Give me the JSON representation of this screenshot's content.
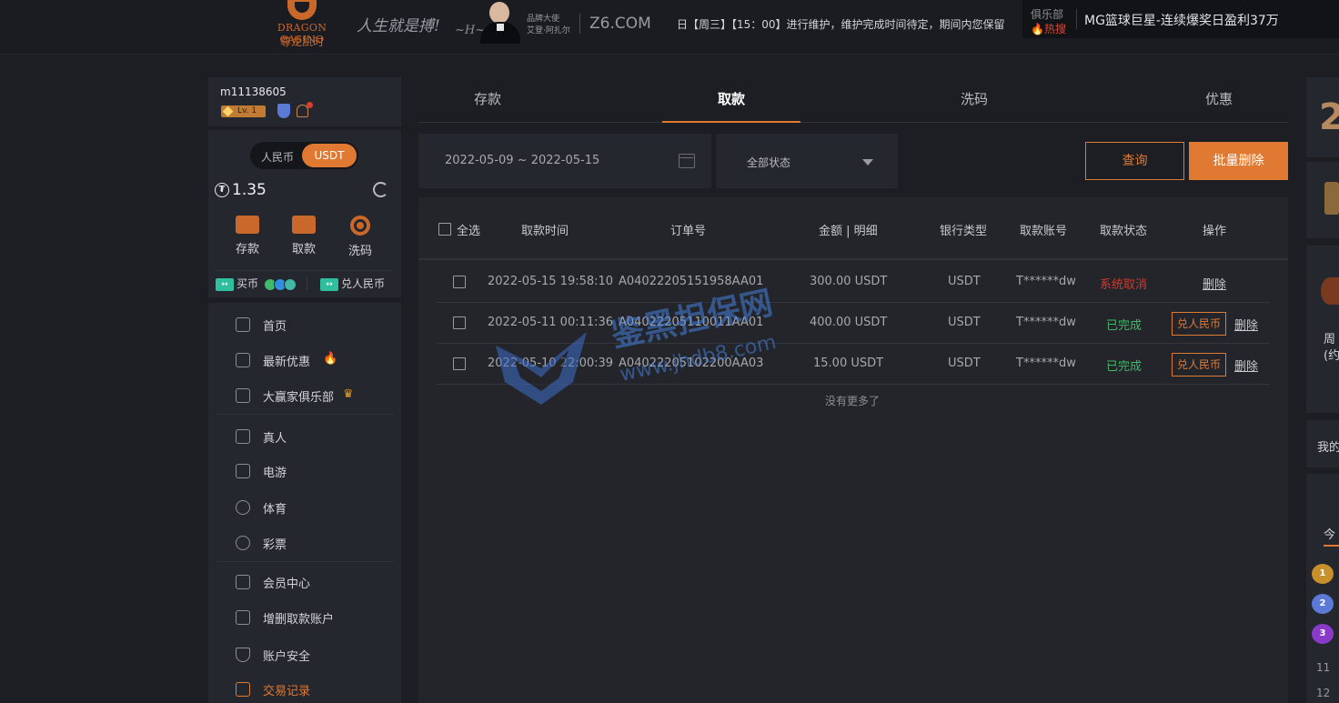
{
  "header": {
    "logo_en": "DRAGON CASINO",
    "logo_cn": "尊龙凯时",
    "slogan": "人生就是搏!",
    "ambassador_line1": "品牌大使",
    "ambassador_line2": "艾登·阿扎尔",
    "domain": "Z6.COM",
    "marquee": "日【周三】【15：00】进行维护，维护完成时间待定，期间内您保留",
    "club_label": "俱乐部",
    "hot_label": "热搜",
    "hot_news": "MG篮球巨星-连续爆奖日盈利37万"
  },
  "sidebar": {
    "username": "m11138605",
    "vip": "Lv. 1",
    "currency_cny": "人民币",
    "currency_usdt": "USDT",
    "balance": "1.35",
    "actions": [
      {
        "label": "存款",
        "icon": "card-icon"
      },
      {
        "label": "取款",
        "icon": "wallet-icon"
      },
      {
        "label": "洗码",
        "icon": "chip-icon"
      }
    ],
    "buy_coin": "买币",
    "exchange": "兑人民币",
    "nav": [
      {
        "label": "首页",
        "icon": "home-icon"
      },
      {
        "label": "最新优惠",
        "icon": "gift-icon"
      },
      {
        "label": "大赢家俱乐部",
        "icon": "chat-icon"
      },
      {
        "label": "真人",
        "icon": "cards-icon"
      },
      {
        "label": "电游",
        "icon": "slot-icon"
      },
      {
        "label": "体育",
        "icon": "ball-icon"
      },
      {
        "label": "彩票",
        "icon": "lottery-icon"
      },
      {
        "label": "会员中心",
        "icon": "id-card-icon"
      },
      {
        "label": "增删取款账户",
        "icon": "bank-card-icon"
      },
      {
        "label": "账户安全",
        "icon": "shield-icon"
      },
      {
        "label": "交易记录",
        "icon": "record-icon"
      }
    ]
  },
  "tabs": [
    "存款",
    "取款",
    "洗码",
    "优惠"
  ],
  "filters": {
    "date_range": "2022-05-09 ~ 2022-05-15",
    "status": "全部状态",
    "query_button": "查询",
    "batch_delete_button": "批量删除"
  },
  "table": {
    "select_all": "全选",
    "headers": [
      "取款时间",
      "订单号",
      "金额 | 明细",
      "银行类型",
      "取款账号",
      "取款状态",
      "操作"
    ],
    "rows": [
      {
        "time": "2022-05-15 19:58:10",
        "order": "A04022205151958AA01",
        "amount": "300.00 USDT",
        "bank": "USDT",
        "account": "T******dw",
        "status": "系统取消",
        "action": "删除"
      },
      {
        "time": "2022-05-11 00:11:36",
        "order": "A04022205110011AA01",
        "amount": "400.00 USDT",
        "bank": "USDT",
        "account": "T******dw",
        "status": "已完成",
        "exchange": "兑人民币",
        "action": "删除"
      },
      {
        "time": "2022-05-10 22:00:39",
        "order": "A04022205102200AA03",
        "amount": "15.00 USDT",
        "bank": "USDT",
        "account": "T******dw",
        "status": "已完成",
        "exchange": "兑人民币",
        "action": "删除"
      }
    ],
    "no_more": "没有更多了"
  },
  "watermark": {
    "text": "鉴黑担保网",
    "url": "www.jhdb8.com"
  },
  "right_panel": {
    "year_digit": "2",
    "text1": "周",
    "text2": "(约",
    "text3": "我的",
    "text4": "今",
    "ranks": [
      "1",
      "2",
      "3"
    ],
    "nums": [
      "11",
      "12"
    ]
  },
  "colors": {
    "accent": "#e07a33",
    "cancel": "#d23a2e",
    "done": "#3fb96a"
  }
}
